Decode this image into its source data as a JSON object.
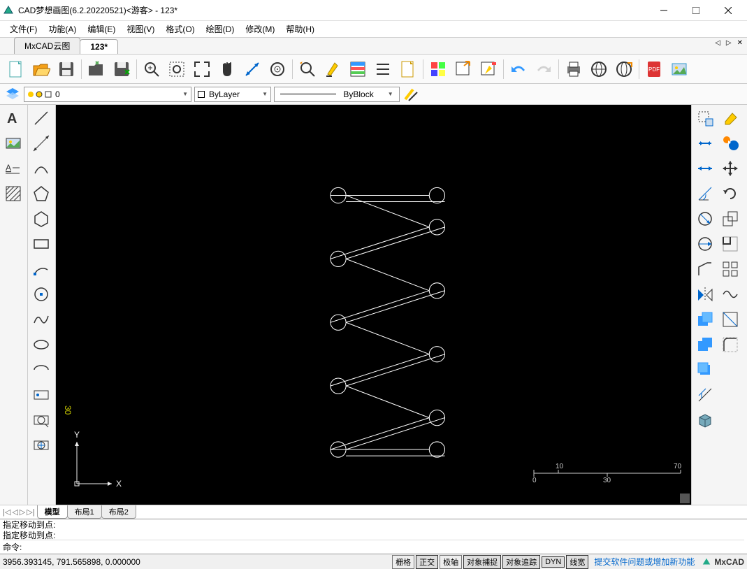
{
  "title": "CAD梦想画图(6.2.20220521)<游客> - 123*",
  "menus": [
    "文件(F)",
    "功能(A)",
    "编辑(E)",
    "视图(V)",
    "格式(O)",
    "绘图(D)",
    "修改(M)",
    "帮助(H)"
  ],
  "doc_tabs": {
    "items": [
      "MxCAD云图",
      "123*"
    ],
    "active": 1
  },
  "layer_bar": {
    "layer": "0",
    "color": "ByLayer",
    "linetype": "ByBlock"
  },
  "model_tabs": {
    "items": [
      "模型",
      "布局1",
      "布局2"
    ],
    "active": 0
  },
  "cmd_history": [
    "指定移动到点:",
    "指定移动到点:"
  ],
  "cmd_prompt": "命令:",
  "cmd_input": "",
  "status": {
    "coords": "3956.393145, 791.565898, 0.000000",
    "toggles": [
      {
        "label": "栅格",
        "on": false
      },
      {
        "label": "正交",
        "on": true
      },
      {
        "label": "极轴",
        "on": false
      },
      {
        "label": "对象捕捉",
        "on": true
      },
      {
        "label": "对象追踪",
        "on": true
      },
      {
        "label": "DYN",
        "on": true
      },
      {
        "label": "线宽",
        "on": true
      }
    ],
    "feedback": "提交软件问题或增加新功能",
    "brand": "MxCAD"
  },
  "ruler": {
    "ticks": [
      "10",
      "70"
    ],
    "mid": "0",
    "mid2": "30"
  },
  "ucs": {
    "x": "X",
    "y": "Y"
  },
  "canvas_label": "30"
}
